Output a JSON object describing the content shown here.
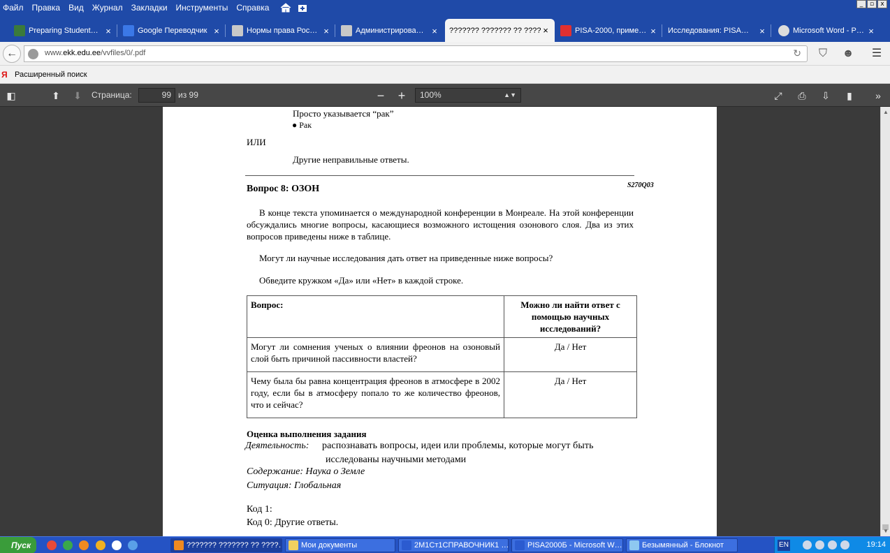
{
  "menu": [
    "Файл",
    "Правка",
    "Вид",
    "Журнал",
    "Закладки",
    "Инструменты",
    "Справка"
  ],
  "window_buttons": [
    "_",
    "▫",
    "x"
  ],
  "tabs": [
    {
      "label": "Preparing Student…",
      "close": "×"
    },
    {
      "label": "Google Переводчик",
      "close": "×"
    },
    {
      "label": "Нормы права Рос…",
      "close": "×"
    },
    {
      "label": "Администрирова…",
      "close": "×"
    },
    {
      "label": "??????? ??????? ?? ????…",
      "close": "×"
    },
    {
      "label": "PISA-2000, приме…",
      "close": "×"
    },
    {
      "label": "Исследования: PISA…",
      "close": "×"
    },
    {
      "label": "Microsoft Word - P…",
      "close": "×"
    }
  ],
  "url": {
    "prefix": "www.",
    "domain": "ekk.edu.ee",
    "path": "/vvfiles/0/.pdf"
  },
  "bookmarks": {
    "icon": "Я",
    "label": "Расширенный поиск"
  },
  "pdf_toolbar": {
    "page_label": "Страница:",
    "page_value": "99",
    "page_of": "из 99",
    "zoom_out": "−",
    "zoom_in": "+",
    "zoom_value": "100%"
  },
  "doc": {
    "line_prosto": "Просто указывается “рак”",
    "bullet_rak": "● Рак",
    "ili": "ИЛИ",
    "drugie": "Другие неправильные ответы.",
    "question_title": "Вопрос 8: ОЗОН",
    "question_code": "S270Q03",
    "para1": "В конце текста упоминается о международной конференции в Монреале. На этой конференции обсуждались многие вопросы, касающиеся возможного истощения озонового слоя. Два из этих вопросов приведены ниже в таблице.",
    "para2": "Могут ли научные исследования дать ответ на приведенные ниже вопросы?",
    "para3": "Обведите кружком «Да» или «Нет» в каждой строке.",
    "table": {
      "header_q": "Вопрос:",
      "header_a": "Можно ли найти ответ с помощью научных исследований?",
      "rows": [
        {
          "q": "Могут ли сомнения ученых о влиянии фреонов на озоновый слой быть причиной пассивности властей?",
          "a": "Да / Нет"
        },
        {
          "q": "Чему была бы равна концентрация фреонов в атмосфере в 2002 году, если бы в атмосферу попало то же количество фреонов, что и сейчас?",
          "a": "Да / Нет"
        }
      ]
    },
    "eval_title": "Оценка выполнения задания",
    "activity_label": "Деятельность:",
    "activity_text1": "распознавать вопросы, идеи или проблемы, которые могут быть",
    "activity_text2": "исследованы научными методами",
    "content_line": "Содержание: Наука о Земле",
    "situation_line": "Ситуация: Глобальная",
    "code1": "Код 1:",
    "code0": "Код 0: Другие ответы."
  },
  "taskbar": {
    "start": "Пуск",
    "tasks": [
      "??????? ??????? ?? ????…",
      "Мои документы",
      "2М1Ст1СПРАВОЧНИК1 …",
      "PISA2000Б - Microsoft W…",
      "Безымянный - Блокнот"
    ],
    "lang": "EN",
    "clock": "19:14"
  }
}
